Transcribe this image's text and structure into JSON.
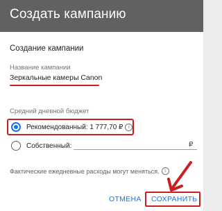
{
  "dialog": {
    "title": "Создать кампанию",
    "section_title": "Создание кампании",
    "name_field": {
      "label": "Название кампании",
      "value": "Зеркальные камеры Canon"
    },
    "budget": {
      "label": "Средний дневной бюджет",
      "options": [
        {
          "label": "Рекомендованный: 1 777,70 ₽",
          "selected": true
        },
        {
          "label": "Собственный:",
          "selected": false
        }
      ],
      "currency_symbol": "₽"
    },
    "note": "Фактические ежедневные расходы могут меняться.",
    "buttons": {
      "cancel": "ОТМЕНА",
      "save": "СОХРАНИТЬ"
    }
  },
  "colors": {
    "header_bg": "#616161",
    "accent": "#1a73e8",
    "annotation": "#cc1e1e"
  },
  "icons": [
    "info-icon",
    "radio-checked-icon",
    "radio-unchecked-icon",
    "annotation-arrow-icon"
  ]
}
